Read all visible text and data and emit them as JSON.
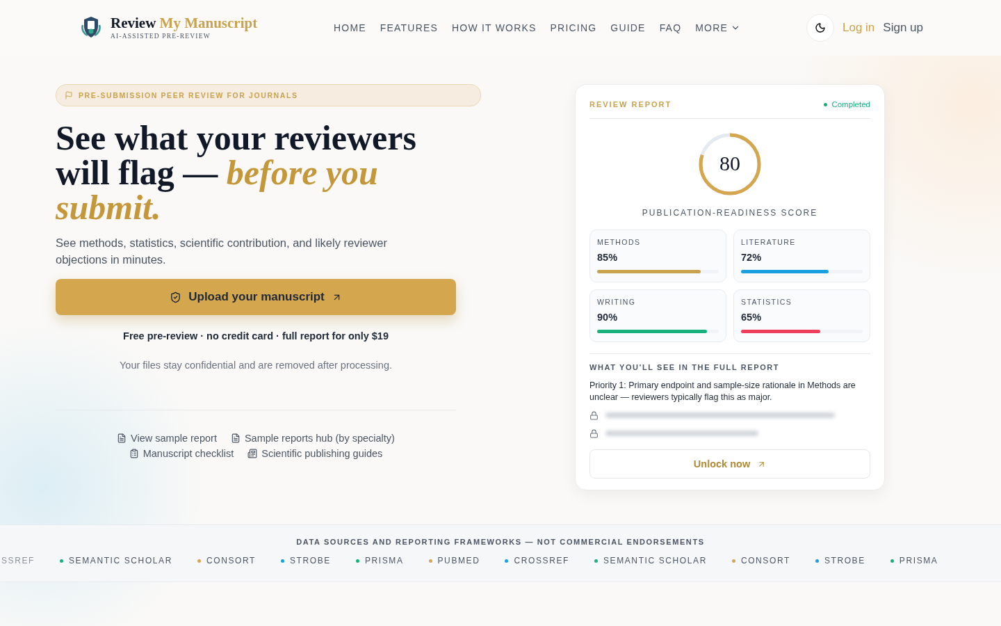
{
  "header": {
    "logo": {
      "title_main": "Review",
      "title_accent": "My Manuscript",
      "tagline": "AI-ASSISTED PRE-REVIEW"
    },
    "nav": [
      {
        "label": "HOME",
        "kind": "link"
      },
      {
        "label": "FEATURES",
        "kind": "link"
      },
      {
        "label": "HOW IT WORKS",
        "kind": "link"
      },
      {
        "label": "PRICING",
        "kind": "link"
      },
      {
        "label": "GUIDE",
        "kind": "link"
      },
      {
        "label": "FAQ",
        "kind": "link"
      },
      {
        "label": "MORE",
        "kind": "dropdown"
      }
    ],
    "login": "Log in",
    "signup": "Sign up"
  },
  "hero": {
    "badge": "PRE-SUBMISSION PEER REVIEW FOR JOURNALS",
    "headline": "See what your reviewers will flag — *before you submit.*",
    "subtitle": "See methods, statistics, scientific contribution, and likely reviewer objections in minutes.",
    "cta": "Upload your manuscript",
    "offer": "Free pre-review · no credit card · full report for only $19",
    "privacy": "Your files stay confidential and are removed after processing.",
    "links": [
      {
        "label": "View sample report",
        "kind": "doc"
      },
      {
        "label": "Sample reports hub (by specialty)",
        "kind": "doc"
      },
      {
        "label": "Manuscript checklist",
        "kind": "checklist"
      },
      {
        "label": "Scientific publishing guides",
        "kind": "guides"
      }
    ]
  },
  "report_card": {
    "title": "REVIEW REPORT",
    "status": "Completed",
    "score": "80",
    "score_ring": {
      "level": 0.8
    },
    "score_label": "PUBLICATION-READINESS SCORE",
    "metrics": [
      {
        "name": "METHODS",
        "value": "85%",
        "level": 0.85,
        "color": "#c9a24e"
      },
      {
        "name": "LITERATURE",
        "value": "72%",
        "level": 0.72,
        "color": "#1a9fe0"
      },
      {
        "name": "WRITING",
        "value": "90%",
        "level": 0.9,
        "color": "#17b27c"
      },
      {
        "name": "STATISTICS",
        "value": "65%",
        "level": 0.65,
        "color": "#ef3e5c"
      }
    ],
    "full_report_heading": "WHAT YOU'LL SEE IN THE FULL REPORT",
    "priority": "Priority 1: Primary endpoint and sample-size rationale in Methods are unclear — reviewers typically flag this as major.",
    "locked_items": [
      {
        "kind": "blurred"
      },
      {
        "kind": "blurred"
      }
    ],
    "unlock": "Unlock now"
  },
  "sources": {
    "heading": "DATA SOURCES AND REPORTING FRAMEWORKS — NOT COMMERCIAL ENDORSEMENTS",
    "items": [
      {
        "label": "SSREF",
        "kind": "faded"
      },
      {
        "label": "SEMANTIC SCHOLAR",
        "color": "#17b27c",
        "kind": "item"
      },
      {
        "label": "CONSORT",
        "color": "#d4a657",
        "kind": "item"
      },
      {
        "label": "STROBE",
        "color": "#1a9fe0",
        "kind": "item"
      },
      {
        "label": "PRISMA",
        "color": "#17b27c",
        "kind": "item"
      },
      {
        "label": "PUBMED",
        "color": "#d4a657",
        "kind": "item"
      },
      {
        "label": "CROSSREF",
        "color": "#1a9fe0",
        "kind": "item"
      },
      {
        "label": "SEMANTIC SCHOLAR",
        "color": "#17b27c",
        "kind": "item"
      },
      {
        "label": "CONSORT",
        "color": "#d4a657",
        "kind": "item"
      },
      {
        "label": "STROBE",
        "color": "#1a9fe0",
        "kind": "item"
      },
      {
        "label": "PRISMA",
        "color": "#17b27c",
        "kind": "item"
      }
    ]
  }
}
